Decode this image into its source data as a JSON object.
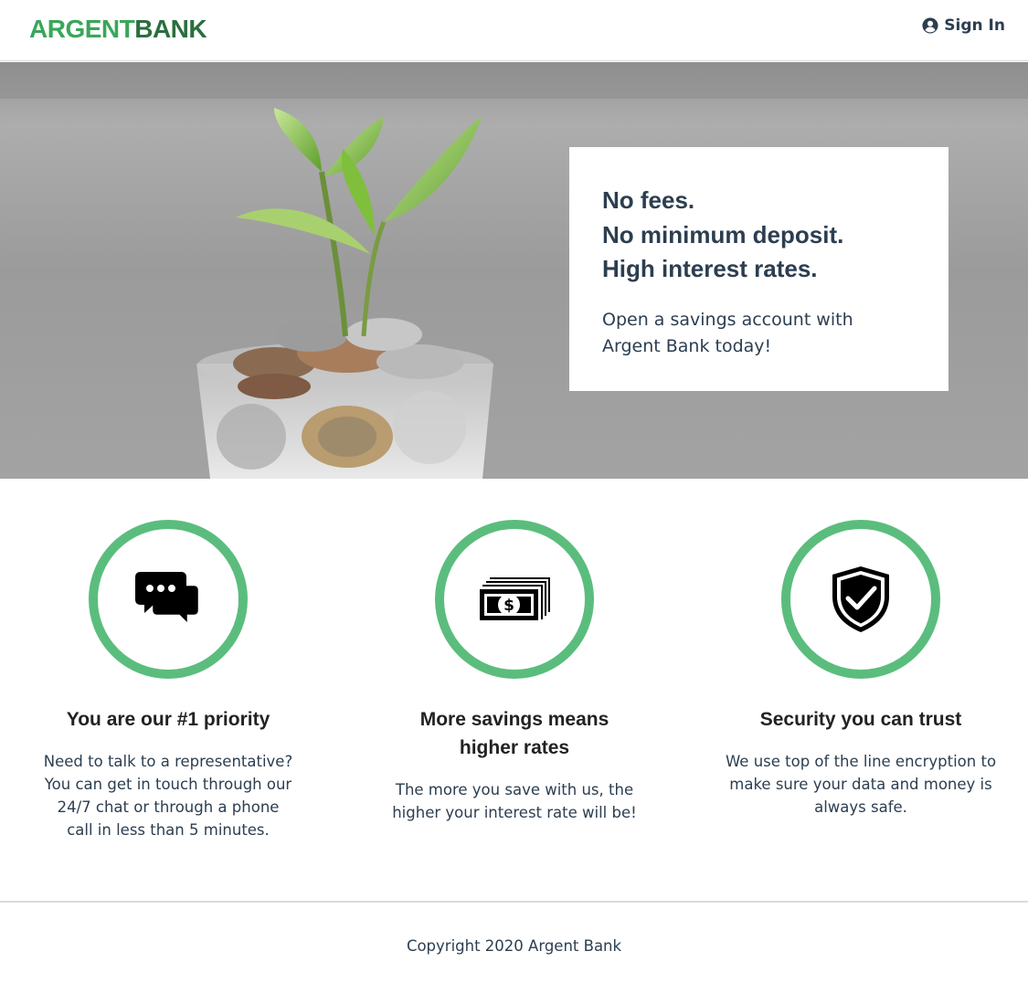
{
  "brand": {
    "name_part1": "ARGENT",
    "name_part2": "BANK"
  },
  "header": {
    "signin_label": "Sign In"
  },
  "hero": {
    "headline": [
      "No fees.",
      "No minimum deposit.",
      "High interest rates."
    ],
    "subtext": "Open a savings account with Argent Bank today!"
  },
  "features": [
    {
      "icon": "chat-bubbles-icon",
      "title": "You are our #1 priority",
      "text": "Need to talk to a representative? You can get in touch through our 24/7 chat or through a phone call in less than 5 minutes."
    },
    {
      "icon": "money-stack-icon",
      "title": "More savings means higher rates",
      "text": "The more you save with us, the higher your interest rate will be!"
    },
    {
      "icon": "shield-check-icon",
      "title": "Security you can trust",
      "text": "We use top of the line encryption to make sure your data and money is always safe."
    }
  ],
  "footer": {
    "copyright": "Copyright 2020 Argent Bank"
  },
  "colors": {
    "brand_green": "#3aa65a",
    "brand_dark_green": "#2b6e3f",
    "ring_green": "#5bbd7d",
    "text": "#2c3e50"
  }
}
